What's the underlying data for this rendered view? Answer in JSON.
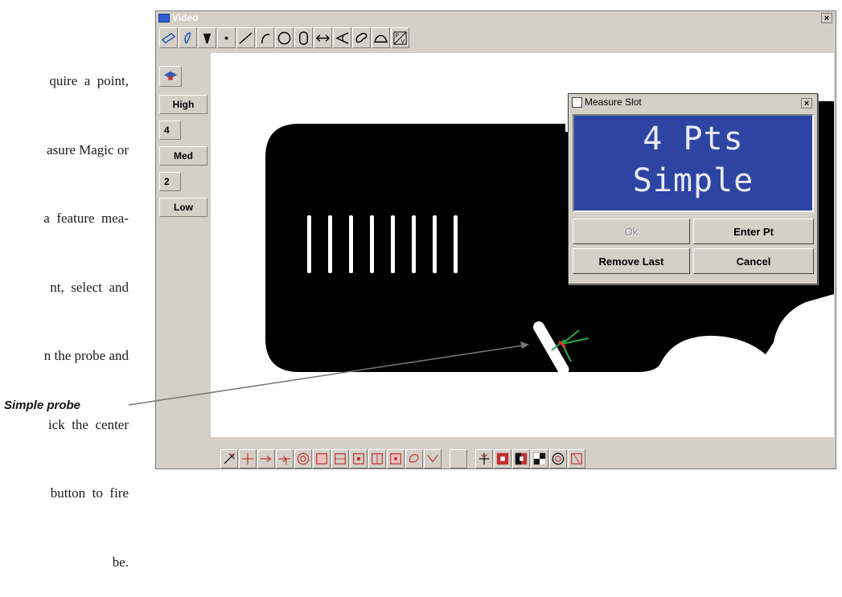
{
  "document": {
    "lines": [
      "quire  a  point,",
      "asure Magic or",
      "a  feature  mea-",
      "nt,  select  and",
      "n the probe and",
      "ick  the  center",
      "button  to  fire",
      "be."
    ],
    "callout_label": "Simple probe"
  },
  "window": {
    "title": "Video",
    "close_label": "×"
  },
  "sidepanel": {
    "buttons": [
      {
        "label": "High"
      },
      {
        "label": "4"
      },
      {
        "label": "Med"
      },
      {
        "label": "2"
      },
      {
        "label": "Low"
      }
    ]
  },
  "dialog": {
    "title": "Measure Slot",
    "close_label": "×",
    "display_line1": "4 Pts",
    "display_line2": "Simple",
    "buttons": {
      "ok": "Ok",
      "enter_pt": "Enter Pt",
      "remove_last": "Remove Last",
      "cancel": "Cancel"
    }
  },
  "colors": {
    "chrome": "#d4d0c8",
    "display_bg": "#2e44a3",
    "part": "#000000",
    "probe_green": "#2aa84a",
    "probe_red": "#e03020"
  }
}
